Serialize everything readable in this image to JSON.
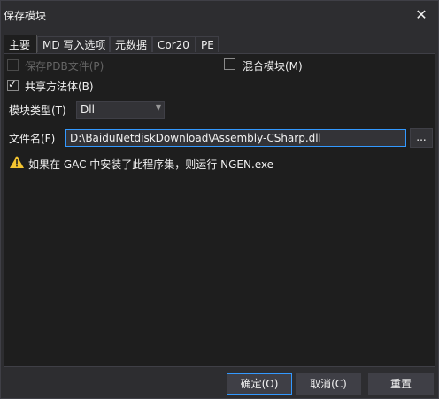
{
  "window": {
    "title": "保存模块",
    "close_glyph": "✕"
  },
  "tabs": [
    {
      "label": "主要",
      "active": true
    },
    {
      "label": "MD 写入选项",
      "active": false
    },
    {
      "label": "元数据",
      "active": false
    },
    {
      "label": "Cor20",
      "active": false
    },
    {
      "label": "PE",
      "active": false
    }
  ],
  "options": {
    "save_pdb": {
      "label": "保存PDB文件(P)",
      "checked": false,
      "enabled": false
    },
    "mixed_module": {
      "label": "混合模块(M)",
      "checked": false,
      "enabled": true
    },
    "share_method_bodies": {
      "label": "共享方法体(B)",
      "checked": true,
      "enabled": true
    }
  },
  "module_type": {
    "label": "模块类型(T)",
    "value": "Dll"
  },
  "file_name": {
    "label": "文件名(F)",
    "value": "D:\\BaiduNetdiskDownload\\Assembly-CSharp.dll",
    "browse_label": "..."
  },
  "warning": {
    "text": "如果在 GAC 中安装了此程序集，则运行 NGEN.exe",
    "icon": "warning-triangle-icon",
    "color": "#f4c430"
  },
  "buttons": {
    "ok": "确定(O)",
    "cancel": "取消(C)",
    "reset": "重置"
  },
  "colors": {
    "background": "#2d2d30",
    "panel": "#1e1e1e",
    "accent": "#3399ff"
  }
}
